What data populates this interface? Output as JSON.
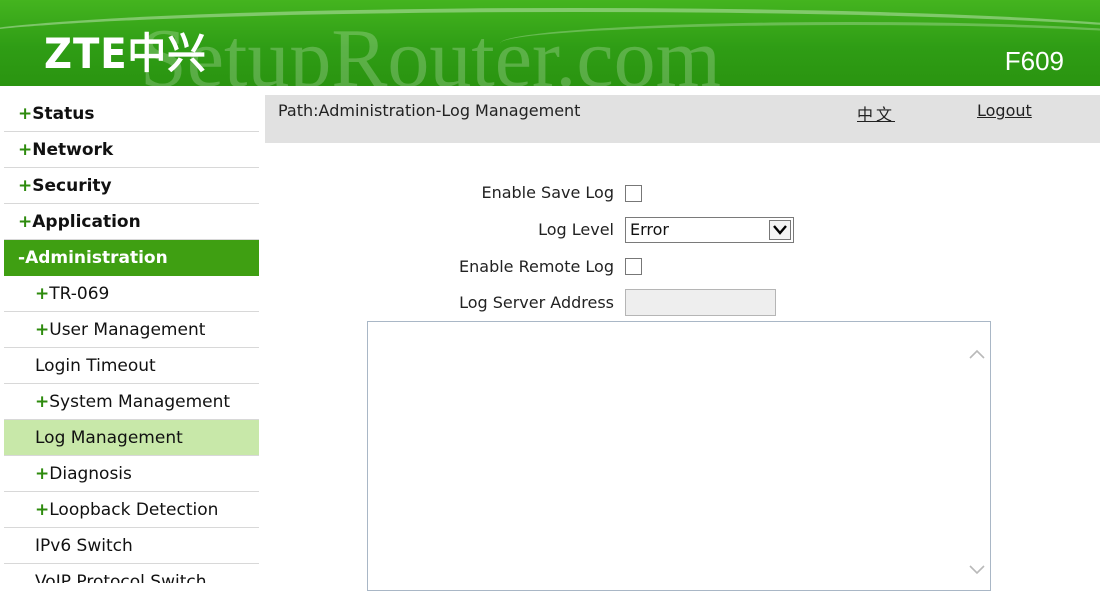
{
  "header": {
    "logo": "ZTE中兴",
    "model": "F609",
    "watermark": "SetupRouter.com",
    "brand_color": "#3a9f16"
  },
  "sidebar": {
    "items": [
      {
        "prefix": "+",
        "label": "Status",
        "level": "top"
      },
      {
        "prefix": "+",
        "label": "Network",
        "level": "top"
      },
      {
        "prefix": "+",
        "label": "Security",
        "level": "top"
      },
      {
        "prefix": "+",
        "label": "Application",
        "level": "top"
      },
      {
        "prefix": "-",
        "label": "Administration",
        "level": "top",
        "active": true
      },
      {
        "prefix": "+",
        "label": "TR-069",
        "level": "sub"
      },
      {
        "prefix": "+",
        "label": "User Management",
        "level": "sub"
      },
      {
        "prefix": "",
        "label": "Login Timeout",
        "level": "sub"
      },
      {
        "prefix": "+",
        "label": "System Management",
        "level": "sub"
      },
      {
        "prefix": "",
        "label": "Log Management",
        "level": "sub",
        "selected": true
      },
      {
        "prefix": "+",
        "label": "Diagnosis",
        "level": "sub"
      },
      {
        "prefix": "+",
        "label": "Loopback Detection",
        "level": "sub"
      },
      {
        "prefix": "",
        "label": "IPv6 Switch",
        "level": "sub"
      },
      {
        "prefix": "",
        "label": "VoIP Protocol Switch",
        "level": "sub"
      }
    ]
  },
  "pathbar": {
    "path": "Path:Administration-Log Management",
    "language": "中文",
    "logout": "Logout"
  },
  "form": {
    "enable_save_log_label": "Enable Save Log",
    "enable_save_log_checked": false,
    "log_level_label": "Log Level",
    "log_level_value": "Error",
    "enable_remote_log_label": "Enable Remote Log",
    "enable_remote_log_checked": false,
    "log_server_label": "Log Server Address",
    "log_server_value": ""
  },
  "log_text": ""
}
